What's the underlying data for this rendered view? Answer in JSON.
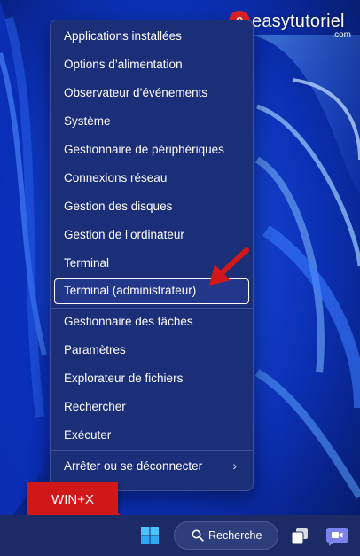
{
  "watermark": {
    "mark": "e",
    "name": "easytutoriel",
    "tld": ".com"
  },
  "context_menu": {
    "items": [
      {
        "label": "Applications installées"
      },
      {
        "label": "Options d’alimentation"
      },
      {
        "label": "Observateur d’événements"
      },
      {
        "label": "Système"
      },
      {
        "label": "Gestionnaire de périphériques"
      },
      {
        "label": "Connexions réseau"
      },
      {
        "label": "Gestion des disques"
      },
      {
        "label": "Gestion de l’ordinateur"
      },
      {
        "label": "Terminal"
      },
      {
        "label": "Terminal (administrateur)"
      },
      {
        "label": "Gestionnaire des tâches"
      },
      {
        "label": "Paramètres"
      },
      {
        "label": "Explorateur de fichiers"
      },
      {
        "label": "Rechercher"
      },
      {
        "label": "Exécuter"
      },
      {
        "label": "Arrêter ou se déconnecter"
      }
    ],
    "selected_item": "Terminal (administrateur)",
    "submenu_chevron": "›"
  },
  "annotation": {
    "shortcut_label": "WIN+X"
  },
  "taskbar": {
    "search_label": "Recherche",
    "icons": [
      "windows-start-icon",
      "search-icon",
      "task-view-icon",
      "teams-chat-icon"
    ]
  },
  "colors": {
    "menu_bg": "#1b2e78",
    "annotation_red": "#d01818",
    "taskbar_bg": "#1c2a66",
    "start_blue": "#4cc2ff"
  }
}
